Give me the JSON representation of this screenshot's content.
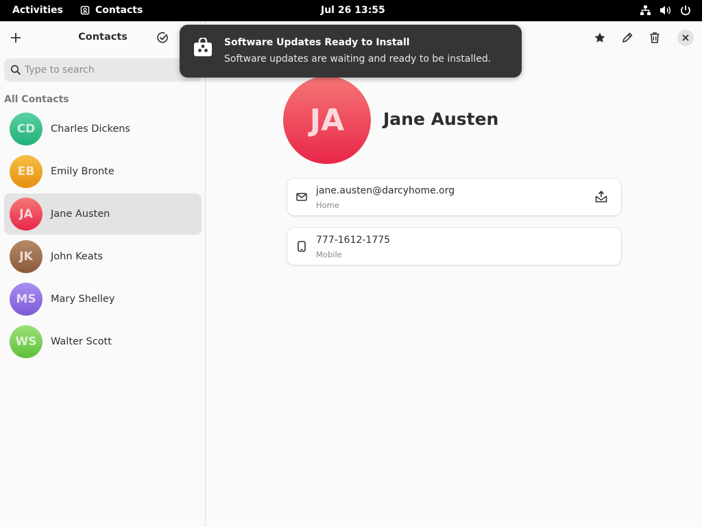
{
  "topbar": {
    "activities": "Activities",
    "app_name": "Contacts",
    "clock": "Jul 26  13:55"
  },
  "sidebar": {
    "title": "Contacts",
    "search_placeholder": "Type to search",
    "group_label": "All Contacts",
    "contacts": [
      {
        "initials": "CD",
        "name": "Charles Dickens",
        "color_top": "#5ad1a0",
        "color_bottom": "#23b07a",
        "selected": false
      },
      {
        "initials": "EB",
        "name": "Emily Bronte",
        "color_top": "#f5c043",
        "color_bottom": "#e6900f",
        "selected": false
      },
      {
        "initials": "JA",
        "name": "Jane Austen",
        "color_top": "#f67676",
        "color_bottom": "#e8264a",
        "selected": true
      },
      {
        "initials": "JK",
        "name": "John Keats",
        "color_top": "#b58a6a",
        "color_bottom": "#8a5b3a",
        "selected": false
      },
      {
        "initials": "MS",
        "name": "Mary Shelley",
        "color_top": "#a88ef0",
        "color_bottom": "#7d5ad6",
        "selected": false
      },
      {
        "initials": "WS",
        "name": "Walter Scott",
        "color_top": "#9be07a",
        "color_bottom": "#5fbf3a",
        "selected": false
      }
    ]
  },
  "detail": {
    "initials": "JA",
    "full_name": "Jane Austen",
    "email": {
      "value": "jane.austen@darcyhome.org",
      "type": "Home"
    },
    "phone": {
      "value": "777-1612-1775",
      "type": "Mobile"
    }
  },
  "notification": {
    "title": "Software Updates Ready to Install",
    "body": "Software updates are waiting and ready to be installed."
  }
}
